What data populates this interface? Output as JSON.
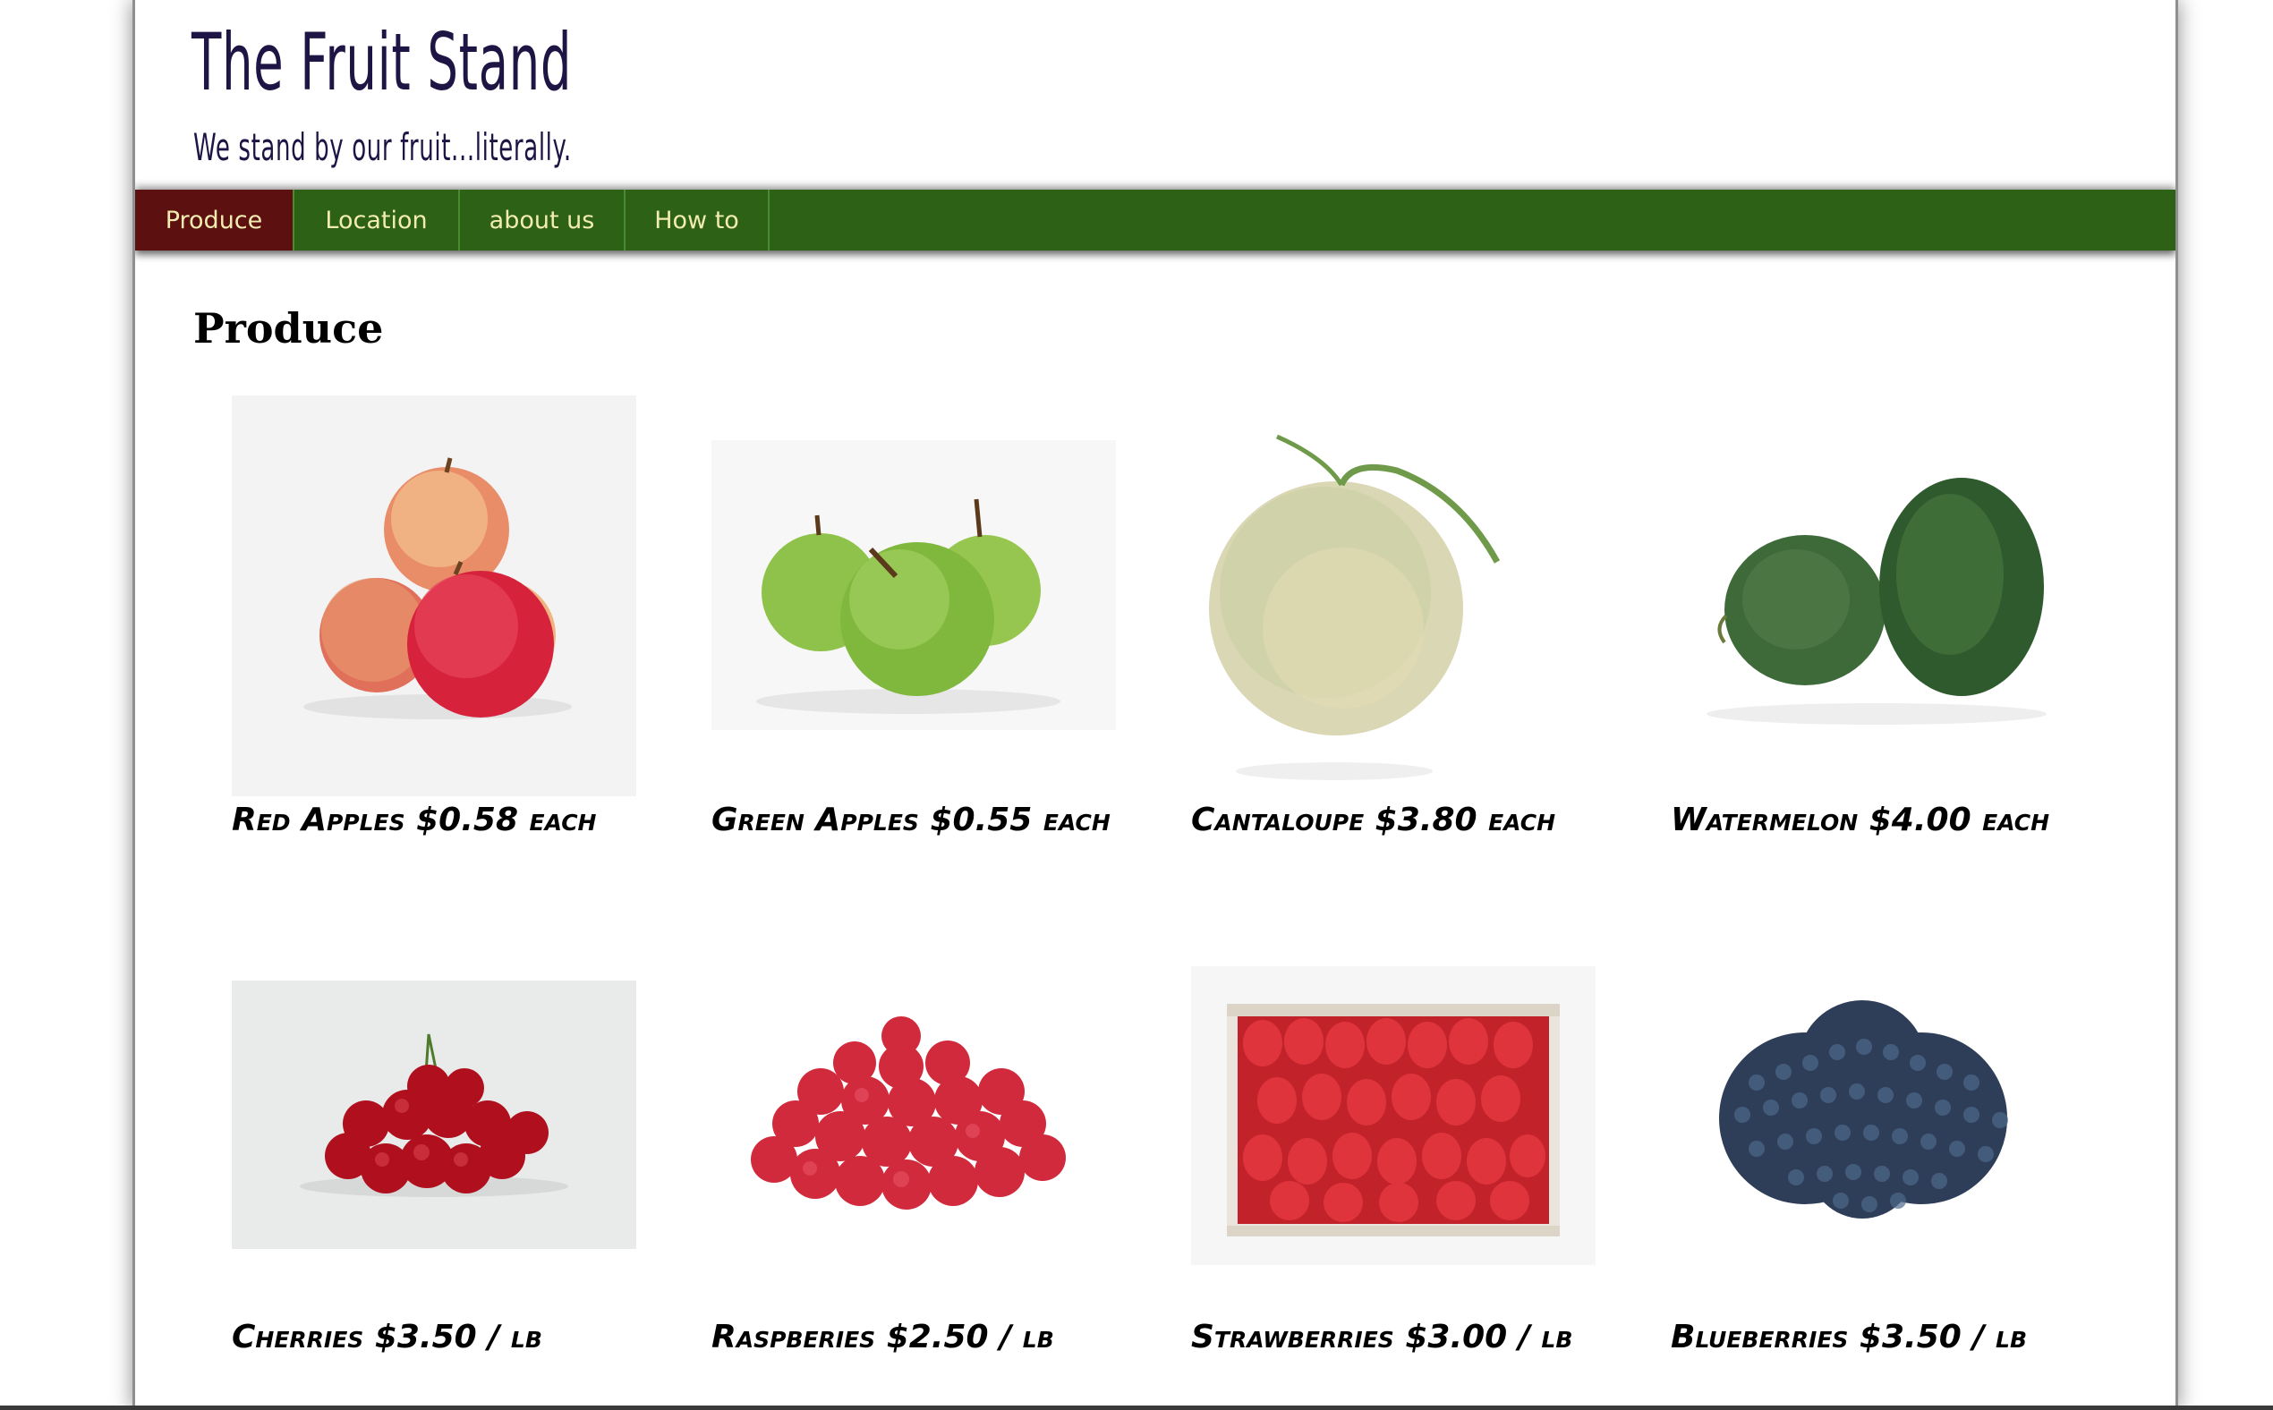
{
  "header": {
    "title": "The Fruit Stand",
    "tagline": "We stand by our fruit...literally."
  },
  "nav": {
    "items": [
      "Produce",
      "Location",
      "about us",
      "How to"
    ],
    "active": "Produce"
  },
  "main": {
    "heading": "Produce",
    "products": [
      {
        "label": "Red Apples $0.58 each"
      },
      {
        "label": "Green Apples $0.55 each"
      },
      {
        "label": "Cantaloupe $3.80 each"
      },
      {
        "label": "Watermelon $4.00 each"
      },
      {
        "label": "Cherries $3.50 / lb"
      },
      {
        "label": "Raspberies $2.50 / lb"
      },
      {
        "label": "Strawberries $3.00 / lb"
      },
      {
        "label": "Blueberries $3.50 / lb"
      }
    ]
  },
  "colors": {
    "nav_bg": "#2c6116",
    "nav_active": "#5c1010",
    "nav_text": "#f3ecb0",
    "title": "#1f1545"
  }
}
